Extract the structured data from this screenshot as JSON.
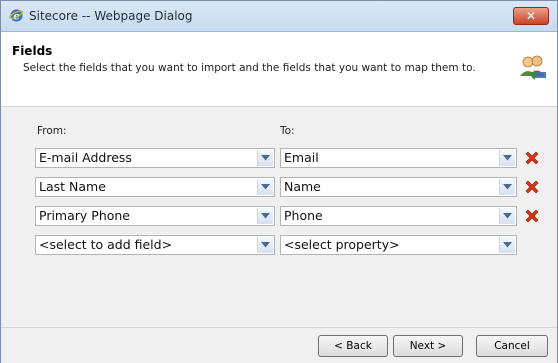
{
  "window": {
    "title": "Sitecore -- Webpage Dialog",
    "close_label": "✕"
  },
  "header": {
    "title": "Fields",
    "subtitle": "Select the fields that you want to import and the fields that you want to map them to."
  },
  "mapping": {
    "from_label": "From:",
    "to_label": "To:",
    "rows": [
      {
        "from": "E-mail Address",
        "to": "Email"
      },
      {
        "from": "Last Name",
        "to": "Name"
      },
      {
        "from": "Primary Phone",
        "to": "Phone"
      },
      {
        "from": "<select to add field>",
        "to": "<select property>"
      }
    ]
  },
  "footer": {
    "back": "< Back",
    "next": "Next >",
    "cancel": "Cancel"
  }
}
